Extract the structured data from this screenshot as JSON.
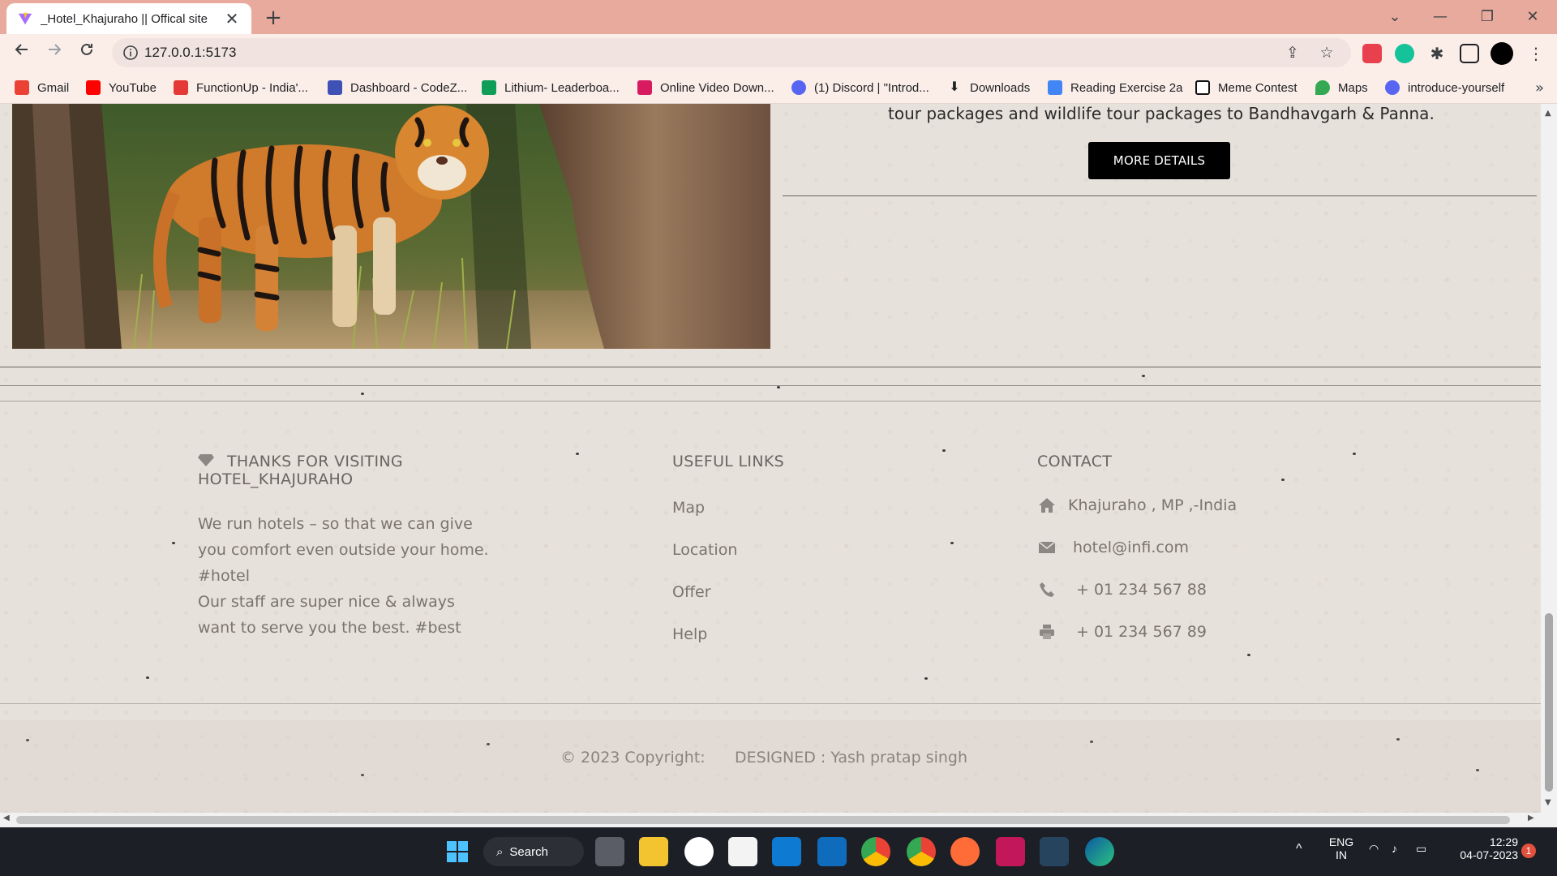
{
  "browser": {
    "tab_title": "_Hotel_Khajuraho || Offical site",
    "tab_close": "✕",
    "new_tab": "+",
    "url": "127.0.0.1:5173",
    "window_controls": {
      "dropdown": "⌄",
      "minimize": "—",
      "restore": "❐",
      "close": "✕"
    },
    "bookmarks": [
      {
        "label": "Gmail",
        "icon": "gmail-icon",
        "color": "#ea4335"
      },
      {
        "label": "YouTube",
        "icon": "youtube-icon",
        "color": "#ff0000"
      },
      {
        "label": "FunctionUp - India'...",
        "icon": "functionup-icon",
        "color": "#e53935"
      },
      {
        "label": "Dashboard - CodeZ...",
        "icon": "codezinger-icon",
        "color": "#3f51b5"
      },
      {
        "label": "Lithium- Leaderboa...",
        "icon": "sheets-icon",
        "color": "#0f9d58"
      },
      {
        "label": "Online Video Down...",
        "icon": "video-download-icon",
        "color": "#d81b60"
      },
      {
        "label": "(1) Discord | \"Introd...",
        "icon": "discord-icon",
        "color": "#5865f2"
      },
      {
        "label": "Downloads",
        "icon": "download-icon",
        "color": "#333333"
      },
      {
        "label": "Reading Exercise 2a",
        "icon": "docs-icon",
        "color": "#4285f4"
      },
      {
        "label": "Meme Contest",
        "icon": "notion-icon",
        "color": "#111111"
      },
      {
        "label": "Maps",
        "icon": "maps-icon",
        "color": "#34a853"
      },
      {
        "label": "introduce-yourself",
        "icon": "discord-icon",
        "color": "#5865f2"
      }
    ],
    "bookmarks_more": "»"
  },
  "page": {
    "tour_text": "tour packages and wildlife tour packages to Bandhavgarh & Panna.",
    "more_details_label": "MORE DETAILS",
    "footer": {
      "brand_title_line1": "THANKS FOR VISITING",
      "brand_title_line2": "HOTEL_KHAJURAHO",
      "brand_text": [
        "We run hotels – so that we can give",
        "you comfort even outside your home.",
        "#hotel",
        "Our staff are super nice & always",
        "want to serve you the best. #best"
      ],
      "links_title": "USEFUL LINKS",
      "links": [
        "Map",
        "Location",
        "Offer",
        "Help"
      ],
      "contact_title": "CONTACT",
      "contact": {
        "address": "Khajuraho , MP ,-India",
        "email": "hotel@infi.com",
        "phone": "+ 01 234 567 88",
        "fax": "+ 01 234 567 89"
      },
      "copyright": "© 2023 Copyright:",
      "designed_by": "DESIGNED : Yash pratap singh"
    }
  },
  "taskbar": {
    "search_label": "Search",
    "lang_line1": "ENG",
    "lang_line2": "IN",
    "time": "12:29",
    "date": "04-07-2023",
    "notification_count": "1"
  }
}
